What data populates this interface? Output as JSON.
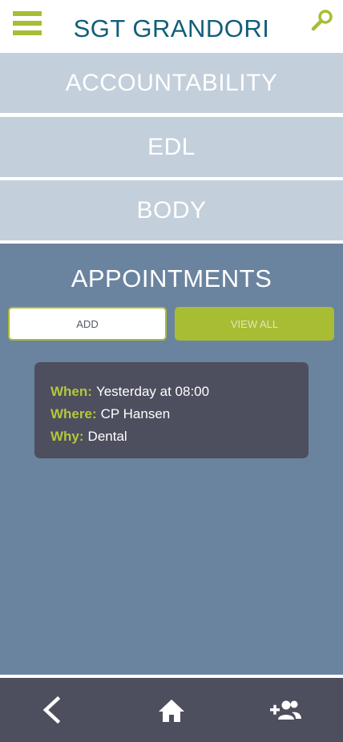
{
  "header": {
    "title": "SGT GRANDORI",
    "menu_icon": "hamburger-menu-icon",
    "search_icon": "search-icon",
    "accent_color": "#a8bd33",
    "title_color": "#125e7a"
  },
  "sections": {
    "accountability": "ACCOUNTABILITY",
    "edl": "EDL",
    "body": "BODY"
  },
  "appointments": {
    "title": "APPOINTMENTS",
    "add_label": "ADD",
    "view_all_label": "VIEW ALL",
    "card": {
      "when_label": "When:",
      "when_value": "Yesterday at 08:00",
      "where_label": "Where:",
      "where_value": "CP Hansen",
      "why_label": "Why:",
      "why_value": "Dental"
    }
  },
  "bottom_nav": {
    "back_icon": "chevron-left-icon",
    "home_icon": "home-icon",
    "add_user_icon": "add-user-icon"
  }
}
